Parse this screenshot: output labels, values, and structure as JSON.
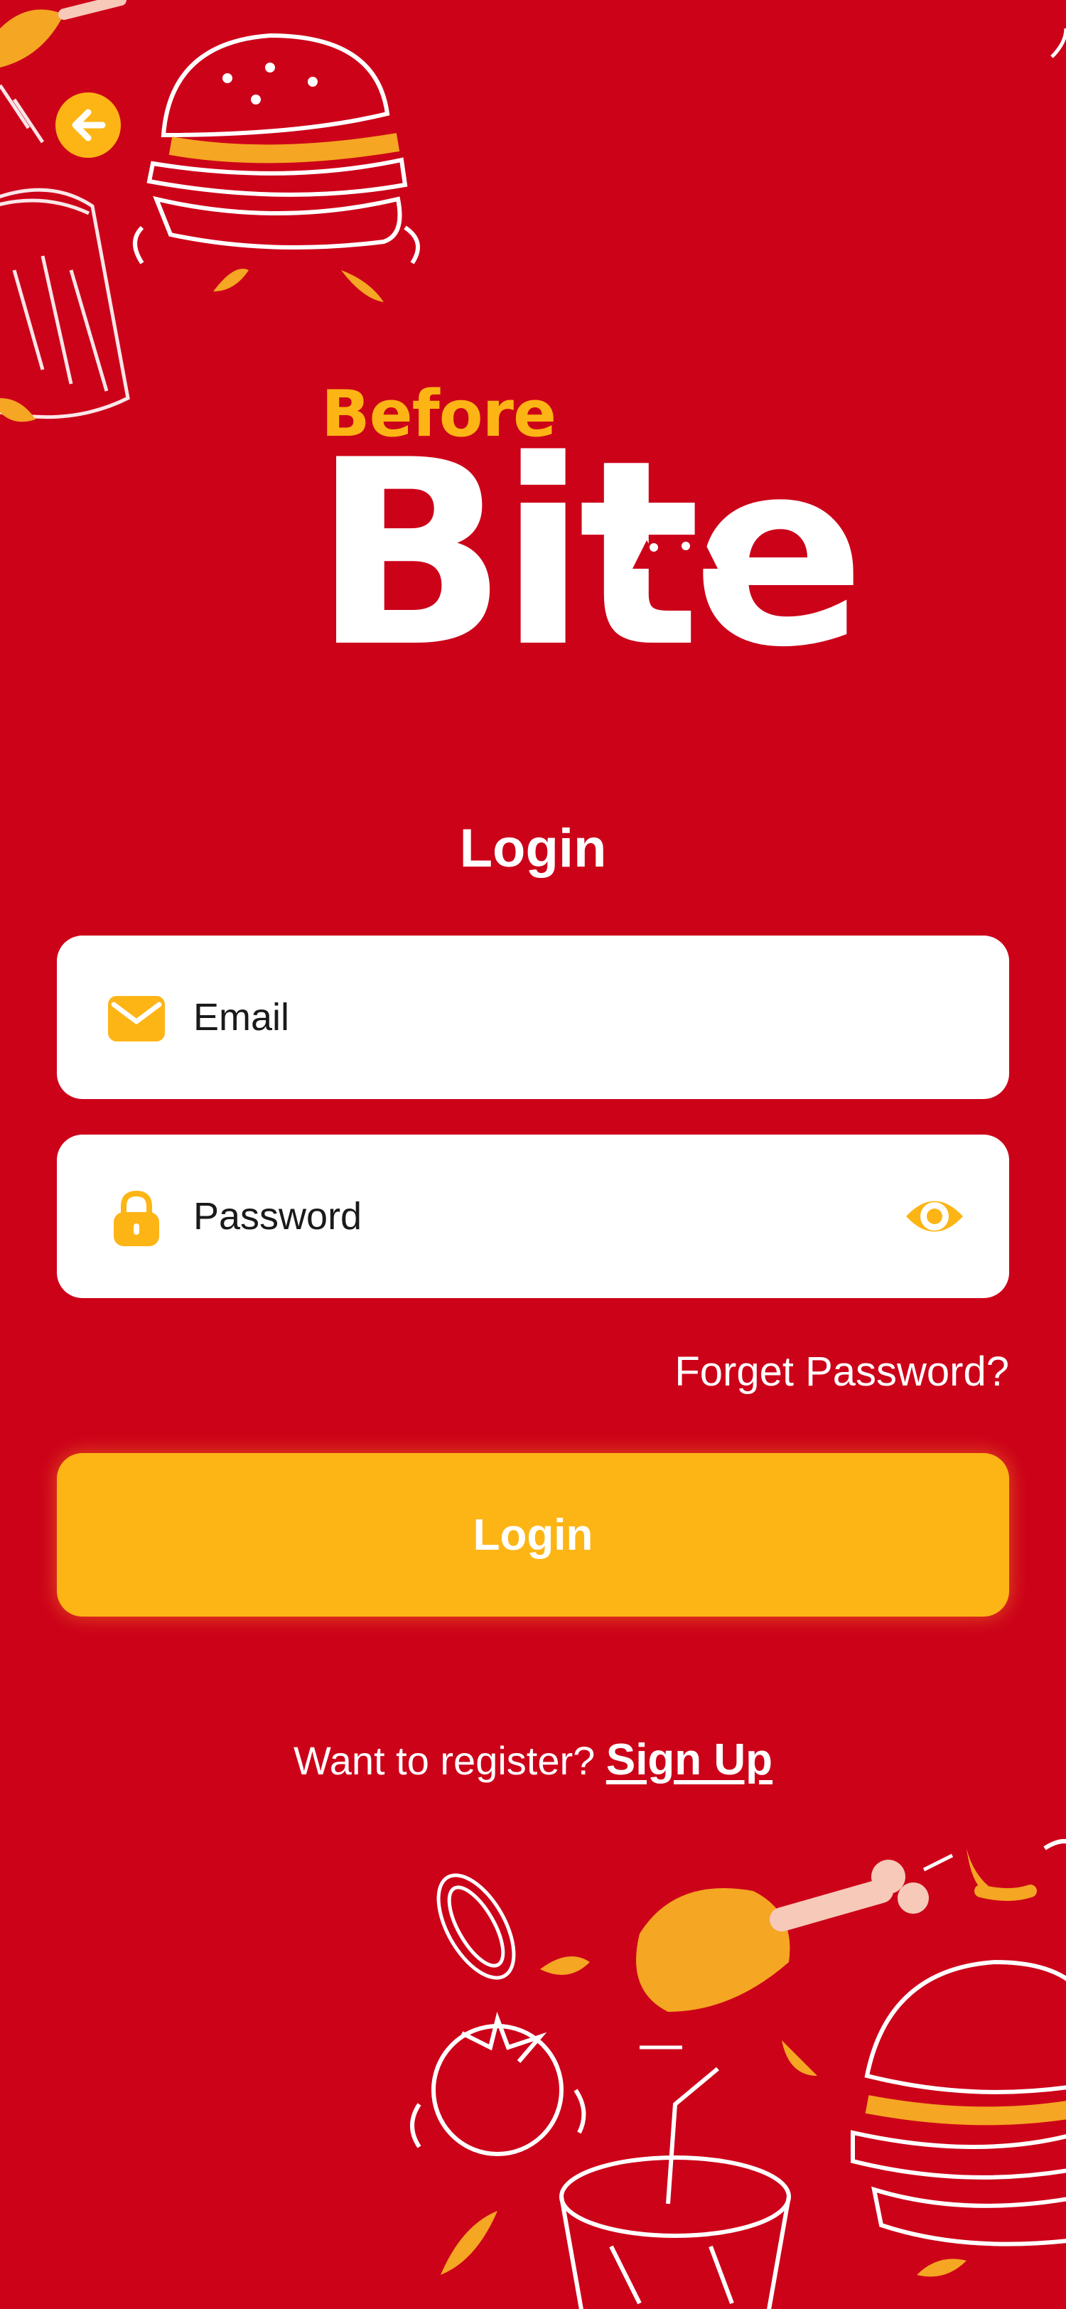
{
  "logo": {
    "before_text": "Before",
    "bite_text": "Bite"
  },
  "login": {
    "title": "Login",
    "email_placeholder": "Email",
    "email_value": "",
    "password_placeholder": "Password",
    "password_value": "",
    "forget_label": "Forget Password?",
    "button_label": "Login"
  },
  "register": {
    "prompt": "Want to register? ",
    "link_label": "Sign Up"
  },
  "icons": {
    "back": "arrow-left-icon",
    "email": "envelope-icon",
    "password": "lock-icon",
    "visibility": "eye-icon"
  },
  "colors": {
    "background": "#cc0219",
    "accent": "#fdb515",
    "field": "#ffffff"
  }
}
